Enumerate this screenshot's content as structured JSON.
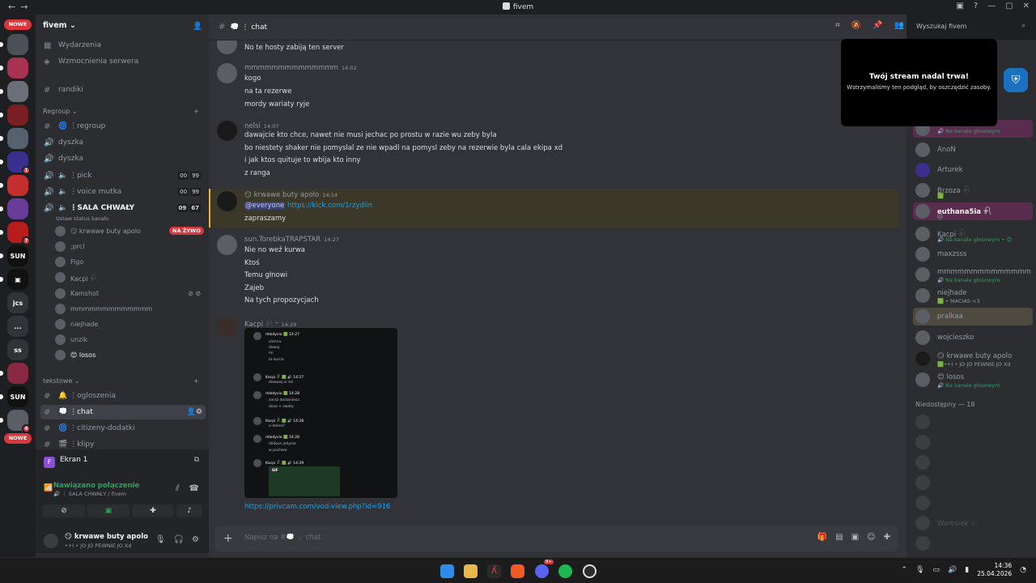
{
  "window": {
    "title": "fivem"
  },
  "rail": {
    "badges": [
      "1",
      "7",
      "4"
    ],
    "tiles": {
      "jcs": "jcs",
      "ss": "ss",
      "more": "..."
    },
    "nowe": "NOWE"
  },
  "server": {
    "name": "fivem"
  },
  "channels": {
    "events": "Wydarzenia",
    "boosts": "Wzmocnienia serwera",
    "randiki": "randiki",
    "cat_regroup": "Regroup",
    "regroup": "regroup",
    "dyszka1": "dyszka",
    "dyszka2": "dyszka",
    "pick": "pick",
    "pick_counts": [
      "00",
      "99"
    ],
    "voice_mutka": "voice mutka",
    "voice_counts": [
      "00",
      "99"
    ],
    "sala": "SALA CHWAŁY",
    "sala_counts": [
      "09",
      "67"
    ],
    "sala_status": "Ustaw status kanału",
    "voice_users": [
      "😏 krwawe buty apolo",
      ";prcl",
      "Figo",
      "Kacpi 𓍯",
      "Kamshot",
      "mmmmmmmmmmmmm",
      "niejhade",
      "unzik",
      "😊 losos"
    ],
    "live": "NA ŻYWO",
    "cat_text": "tekstowe",
    "ogloszenia": "ogloszenia",
    "chat": "chat",
    "citizeny": "citizeny-dodatki",
    "klipy": "klipy"
  },
  "screen": {
    "label": "Ekran 1",
    "initial": "F"
  },
  "connection": {
    "title": "Nawiązano połączenie",
    "sub": "🔊 ⋮ SALA CHWAŁY / fivem"
  },
  "me": {
    "name": "😏 krwawe buty apolo",
    "status": "•+I • JO JO PEWNIE JO Xd"
  },
  "header": {
    "channel": "chat",
    "search_placeholder": "Wyszukaj fivem"
  },
  "messages": {
    "m0": {
      "line": "No te hosty zabiją ten server"
    },
    "m1": {
      "author": "mmmmmmmmmmmmmm",
      "time": "14:02",
      "lines": [
        "kogo",
        "na ta rezerwe",
        "mordy wariaty ryje"
      ]
    },
    "m2": {
      "author": "nelsi",
      "time": "14:07",
      "lines": [
        "dawajcie kto chce, nawet nie musi jechac po prostu w razie wu zeby byla",
        "bo niestety shaker nie pomyslal ze nie wpadl na pomysl zeby na rezerwie byla cala ekipa xd",
        "i jak ktos quituje to wbija kto inny",
        "z ranga"
      ]
    },
    "m3": {
      "author": "😏 krwawe buty apolo",
      "time": "14:14",
      "mention": "@everyone",
      "link": "https://kick.com/1rzydlin",
      "line2": "zapraszamy"
    },
    "m4": {
      "author": "sun.TorebkaTRAPSTAR",
      "time": "14:27",
      "lines": [
        "Nie no weź kurwa",
        "Ktoś",
        "Temu głnowi",
        "Zajeb",
        "Na tych propozycjach"
      ]
    },
    "m5": {
      "author": "Kacpi 𓍯 ᐩ",
      "time": "14:29",
      "link": "https://privcam.com/vod-view.php?id=916"
    }
  },
  "screenshot_img": {
    "lines": [
      "młodyvio 🟩 14:27",
      "vienna",
      "dawaj",
      "mi",
      "to kurna",
      "Kacpi 𓍯 🟩 🔊 14:27",
      "dawwaj xr tel",
      "młodyvio 🟩 14:28",
      "zaraz dostaniesz",
      "dosa + swata",
      "Kacpi 𓍯 🟩 🔊 14:28",
      "a ddosa?",
      "młodyvio 🟩 14:28",
      "dildosa jedynie",
      "w pochwa",
      "Kacpi 𓍯 🟩 🔊 14:29"
    ],
    "gif": "GIF"
  },
  "input": {
    "placeholder": "Napisz na #💭 ⋮ chat"
  },
  "toast": {
    "title": "Twój stream nadal trwa!",
    "body": "Wstrzymaliśmy ten podgląd, by oszczędzić zasoby."
  },
  "members": {
    "online": [
      {
        "name": "",
        "sub": "🔊 Na kanale głosowym"
      },
      {
        "name": "AnoN",
        "sub": ""
      },
      {
        "name": "Arturek",
        "sub": ""
      },
      {
        "name": "Brzoza 𓍯",
        "sub": "🟩"
      },
      {
        "name": "euthana5ia 𓍯",
        "sub": "🐱"
      },
      {
        "name": "Kacpi 𓍯",
        "sub": "🔊 Na kanale głosowym • 😊"
      },
      {
        "name": "maxzsss",
        "sub": ""
      },
      {
        "name": "mmmmmmmmmmmmmm",
        "sub": "🔊 Na kanale głosowym"
      },
      {
        "name": "niejhade",
        "sub": "🟩 • MACIAS <3"
      },
      {
        "name": "pralkaa",
        "sub": ""
      },
      {
        "name": "wojcieszko",
        "sub": ""
      },
      {
        "name": "😏 krwawe buty apolo",
        "sub": "🟩•+I • JO JO PEWNIE JO Xd"
      },
      {
        "name": "😊 losos",
        "sub": "🔊 Na kanale głosowym"
      }
    ],
    "offline_title": "Niedostępny — 18",
    "offline": [
      "",
      "",
      "",
      "",
      "",
      "Waresiek 𓍯",
      ""
    ]
  },
  "taskbar": {
    "time": "14:36",
    "date": "25.04.2026",
    "discord_badge": "9+"
  },
  "colors": {
    "accent": "#5865f2",
    "online": "#23a55a",
    "danger": "#da373c",
    "link": "#00a8fc"
  }
}
